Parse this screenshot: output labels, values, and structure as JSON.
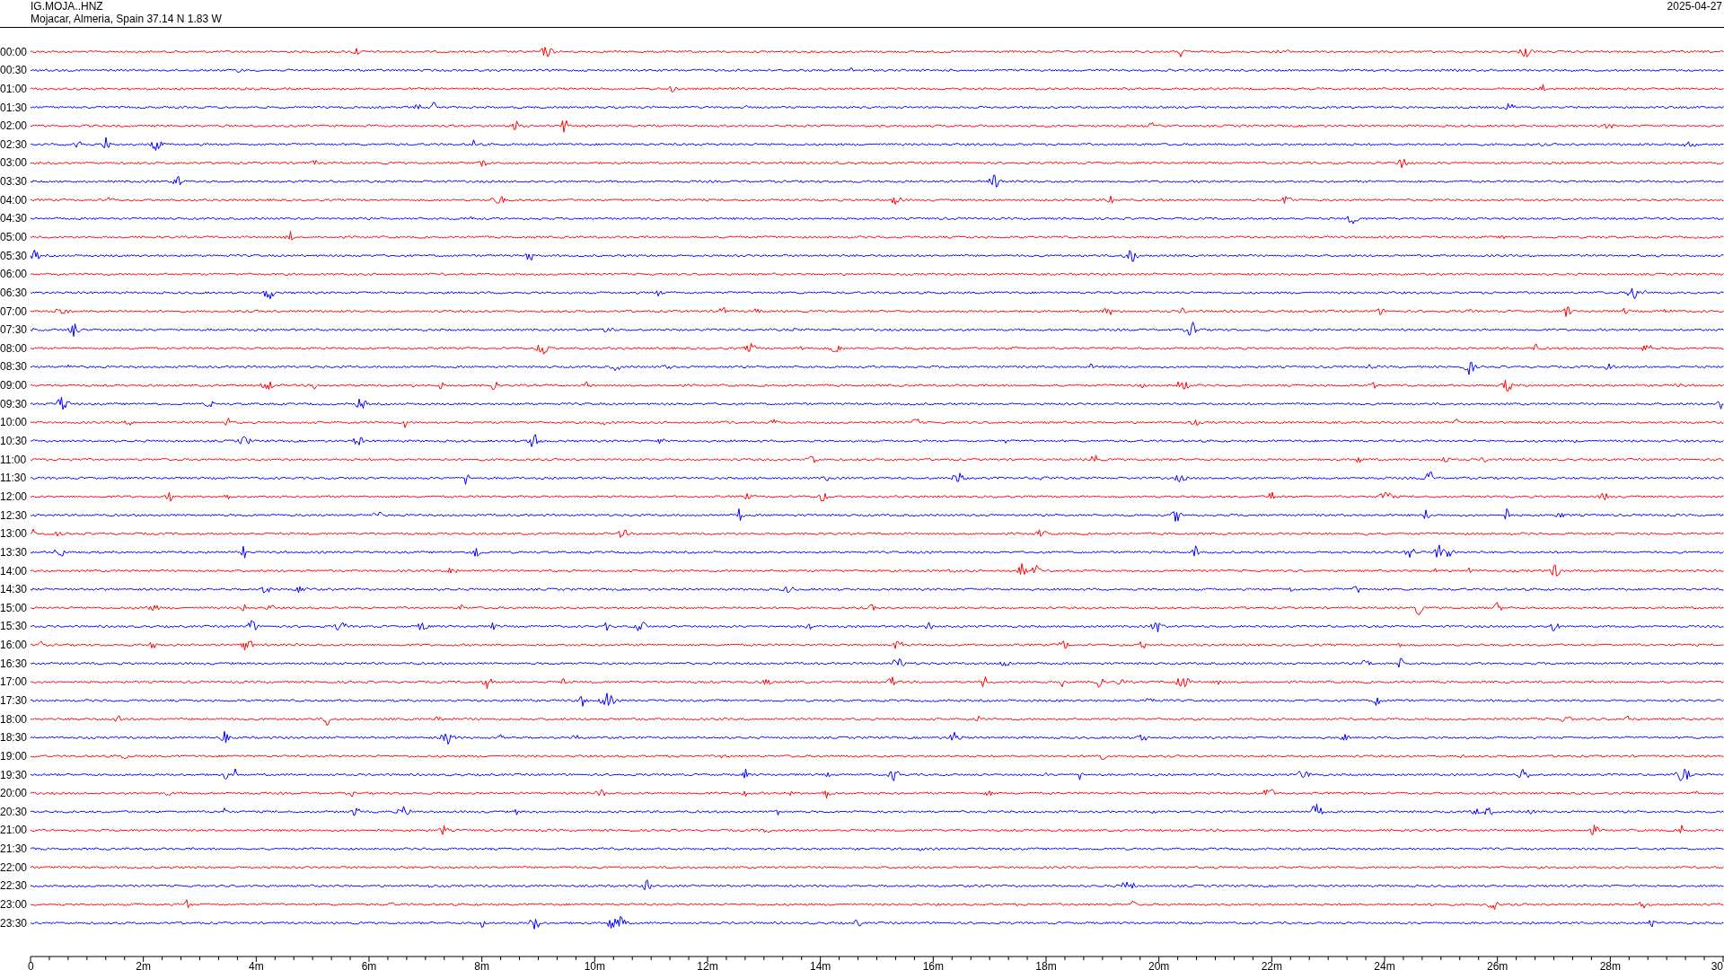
{
  "header": {
    "station": "IG.MOJA..HNZ",
    "location": "Mojacar, Almeria, Spain  37.14 N 1.83 W",
    "date": "2025-04-27"
  },
  "rows": [
    {
      "label": "00:00",
      "color": "#ff0000"
    },
    {
      "label": "00:30",
      "color": "#0000ff"
    },
    {
      "label": "01:00",
      "color": "#ff0000"
    },
    {
      "label": "01:30",
      "color": "#0000ff"
    },
    {
      "label": "02:00",
      "color": "#ff0000"
    },
    {
      "label": "02:30",
      "color": "#0000ff"
    },
    {
      "label": "03:00",
      "color": "#ff0000"
    },
    {
      "label": "03:30",
      "color": "#0000ff"
    },
    {
      "label": "04:00",
      "color": "#ff0000"
    },
    {
      "label": "04:30",
      "color": "#0000ff"
    },
    {
      "label": "05:00",
      "color": "#ff0000"
    },
    {
      "label": "05:30",
      "color": "#0000ff"
    },
    {
      "label": "06:00",
      "color": "#ff0000"
    },
    {
      "label": "06:30",
      "color": "#0000ff"
    },
    {
      "label": "07:00",
      "color": "#ff0000"
    },
    {
      "label": "07:30",
      "color": "#0000ff"
    },
    {
      "label": "08:00",
      "color": "#ff0000"
    },
    {
      "label": "08:30",
      "color": "#0000ff"
    },
    {
      "label": "09:00",
      "color": "#ff0000"
    },
    {
      "label": "09:30",
      "color": "#0000ff"
    },
    {
      "label": "10:00",
      "color": "#ff0000"
    },
    {
      "label": "10:30",
      "color": "#0000ff"
    },
    {
      "label": "11:00",
      "color": "#ff0000"
    },
    {
      "label": "11:30",
      "color": "#0000ff"
    },
    {
      "label": "12:00",
      "color": "#ff0000"
    },
    {
      "label": "12:30",
      "color": "#0000ff"
    },
    {
      "label": "13:00",
      "color": "#ff0000"
    },
    {
      "label": "13:30",
      "color": "#0000ff"
    },
    {
      "label": "14:00",
      "color": "#ff0000"
    },
    {
      "label": "14:30",
      "color": "#0000ff"
    },
    {
      "label": "15:00",
      "color": "#ff0000"
    },
    {
      "label": "15:30",
      "color": "#0000ff"
    },
    {
      "label": "16:00",
      "color": "#ff0000"
    },
    {
      "label": "16:30",
      "color": "#0000ff"
    },
    {
      "label": "17:00",
      "color": "#ff0000"
    },
    {
      "label": "17:30",
      "color": "#0000ff"
    },
    {
      "label": "18:00",
      "color": "#ff0000"
    },
    {
      "label": "18:30",
      "color": "#0000ff"
    },
    {
      "label": "19:00",
      "color": "#ff0000"
    },
    {
      "label": "19:30",
      "color": "#0000ff"
    },
    {
      "label": "20:00",
      "color": "#ff0000"
    },
    {
      "label": "20:30",
      "color": "#0000ff"
    },
    {
      "label": "21:00",
      "color": "#ff0000"
    },
    {
      "label": "21:30",
      "color": "#0000ff"
    },
    {
      "label": "22:00",
      "color": "#ff0000"
    },
    {
      "label": "22:30",
      "color": "#0000ff"
    },
    {
      "label": "23:00",
      "color": "#ff0000"
    },
    {
      "label": "23:30",
      "color": "#0000ff"
    }
  ],
  "x_axis": {
    "ticks": [
      "0",
      "2m",
      "4m",
      "6m",
      "8m",
      "10m",
      "12m",
      "14m",
      "16m",
      "18m",
      "20m",
      "22m",
      "24m",
      "26m",
      "28m",
      "30"
    ]
  }
}
